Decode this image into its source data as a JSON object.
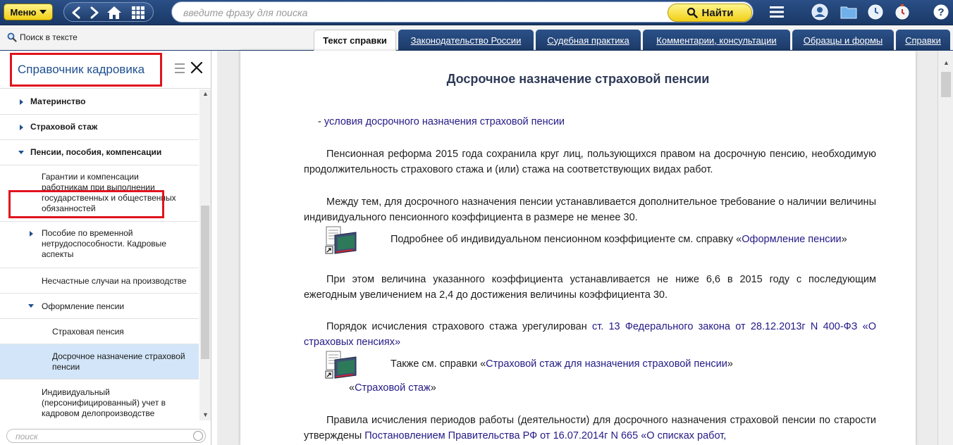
{
  "topbar": {
    "menu_label": "Меню",
    "search_placeholder": "введите фразу для поиска",
    "find_label": "Найти"
  },
  "toolbar": {
    "search_in_text": "Поиск в тексте",
    "tabs": [
      {
        "label": "Текст справки",
        "active": true
      },
      {
        "label": "Законодательство России",
        "active": false
      },
      {
        "label": "Судебная практика",
        "active": false
      },
      {
        "label": "Комментарии, консультации",
        "active": false
      },
      {
        "label": "Образцы и формы",
        "active": false
      },
      {
        "label": "Справки",
        "active": false
      }
    ]
  },
  "sidebar": {
    "title": "Справочник кадровика",
    "search_placeholder": "поиск",
    "items": [
      {
        "label": "Материнство"
      },
      {
        "label": "Страховой стаж"
      },
      {
        "label": "Пенсии, пособия, компенсации"
      },
      {
        "label": "Гарантии и компенсации работникам при выполнении государственных и общественных обязанностей"
      },
      {
        "label": "Пособие по временной нетрудоспособности. Кадровые аспекты"
      },
      {
        "label": "Несчастные случаи на производстве"
      },
      {
        "label": "Оформление пенсии"
      },
      {
        "label": "Страховая пенсия"
      },
      {
        "label": "Досрочное назначение страховой пенсии"
      },
      {
        "label": "Индивидуальный (персонифицированный) учет в кадровом делопроизводстве"
      }
    ]
  },
  "document": {
    "title": "Досрочное назначение страховой пенсии",
    "bullet_prefix": "- ",
    "bullet_link": "условия досрочного назначения страховой пенсии",
    "p1": "Пенсионная реформа 2015 года сохранила круг лиц, пользующихся правом на досрочную пенсию, необходимую продолжительность страхового стажа и (или) стажа на соответствующих видах работ.",
    "p2_a": "Между тем, для досрочного назначения пенсии ",
    "p2_link": "устанавливается дополнительное требование",
    "p2_b": " о наличии величины индивидуального пенсионного коэффициента в размере не менее 30.",
    "note1_a": "Подробнее об индивидуальном пенсионном коэффициенте см. справку «",
    "note1_link": "Оформление пенсии",
    "note1_b": "»",
    "p3": "При этом величина указанного коэффициента устанавливается не ниже 6,6 в 2015 году с последующим ежегодным увеличением на 2,4 до достижения величины коэффициента 30.",
    "p4_a": "Порядок исчисления страхового стажа урегулирован ",
    "p4_link": "ст. 13 Федерального закона от 28.12.2013г N 400-ФЗ «О страховых пенсиях»",
    "note2_a": "Также см. справки «",
    "note2_link1": "Страховой стаж для назначения страховой пенсии",
    "note2_b": "»",
    "note2_c": "«",
    "note2_link2": "Страховой стаж",
    "note2_d": "»",
    "p5_a": "Правила исчисления периодов работы (деятельности) для досрочного назначения страховой пенсии по старости утверждены ",
    "p5_link": "Постановлением Правительства РФ от 16.07.2014г N 665 «О списках работ,"
  }
}
